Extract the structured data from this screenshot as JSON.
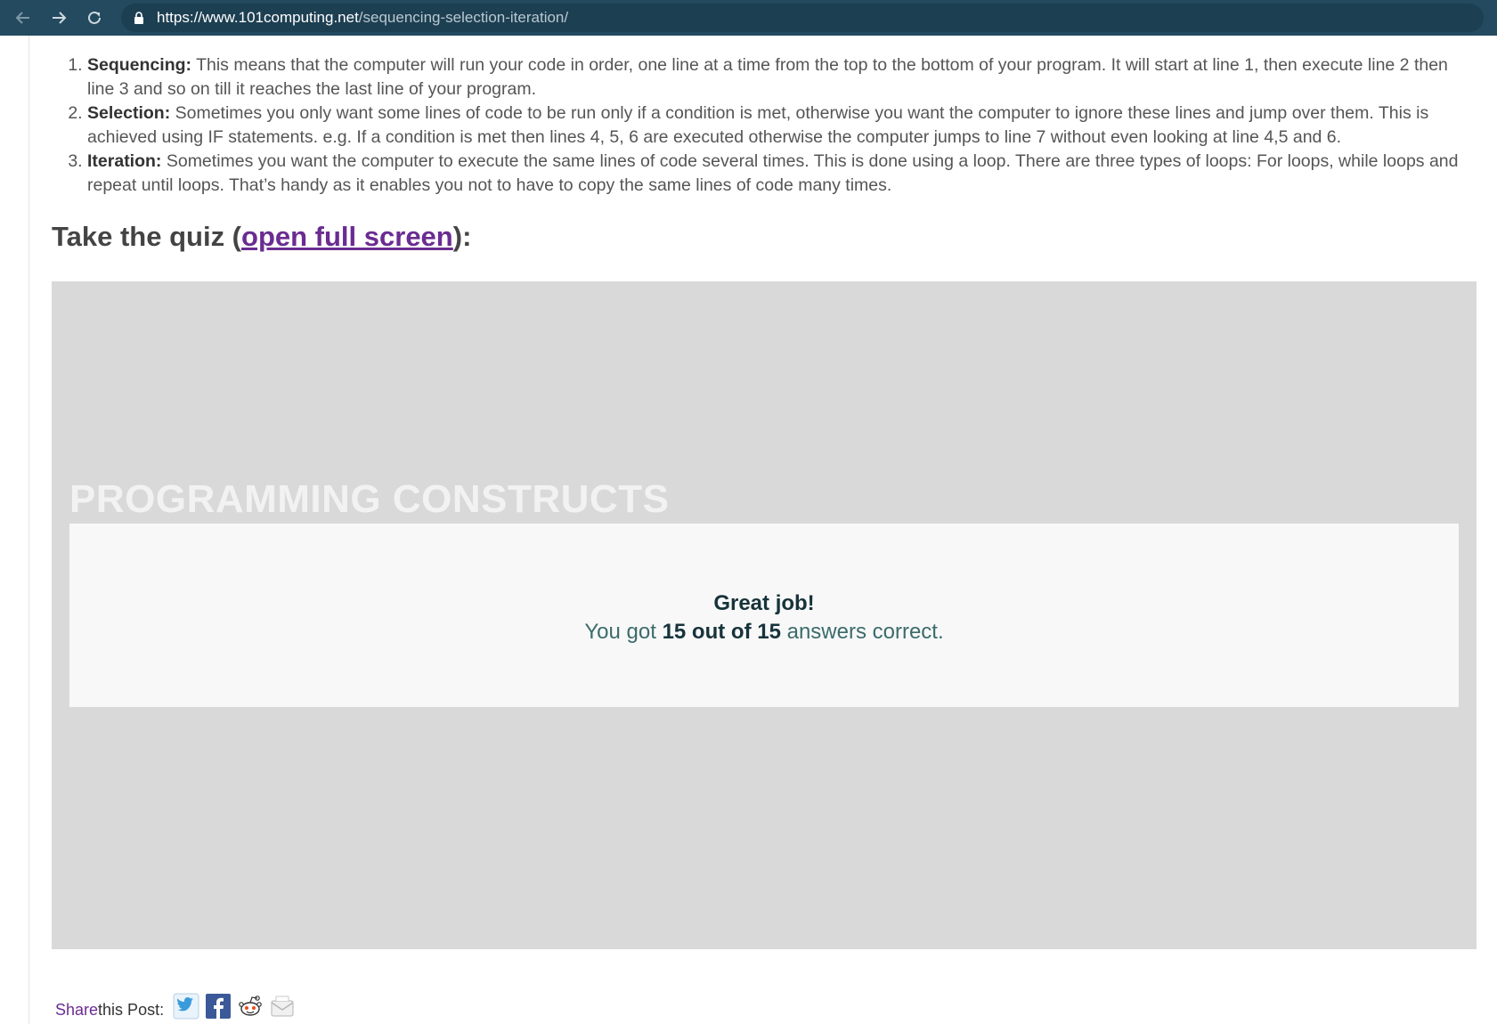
{
  "browser": {
    "url_host": "https://www.101computing.net",
    "url_path": "/sequencing-selection-iteration/"
  },
  "constructs": [
    {
      "term": "Sequencing:",
      "text": " This means that the computer will run your code in order, one line at a time from the top to the bottom of your program. It will start at line 1, then execute line 2 then line 3 and so on till it reaches the last line of your program."
    },
    {
      "term": "Selection:",
      "text": " Sometimes you only want some lines of code to be run only if a condition is met, otherwise you want the computer to ignore these lines and jump over them. This is achieved using IF statements. e.g. If a condition is met then lines 4, 5, 6 are executed otherwise the computer jumps to line 7 without even looking at line 4,5 and 6."
    },
    {
      "term": "Iteration:",
      "text": " Sometimes you want the computer to execute the same lines of code several times. This is done using a loop. There are three types of loops: For loops, while loops and repeat until loops. That’s handy as it enables you not to have to copy the same lines of code many times."
    }
  ],
  "quiz_heading": {
    "prefix": "Take the quiz (",
    "link": "open full screen",
    "suffix": "):"
  },
  "quiz": {
    "title": "PROGRAMMING CONSTRUCTS",
    "result_headline": "Great job!",
    "result_prefix": "You got ",
    "result_score": "15 out of 15",
    "result_suffix": " answers correct."
  },
  "share": {
    "accent": "Share",
    "rest": "this Post:",
    "icons": [
      "twitter-icon",
      "facebook-icon",
      "reddit-icon",
      "email-icon"
    ]
  },
  "colors": {
    "toolbar": "#234a5f",
    "link": "#6a2c91",
    "quiz_bg": "#d9d9d9",
    "result_bg": "#f8f8f8"
  }
}
